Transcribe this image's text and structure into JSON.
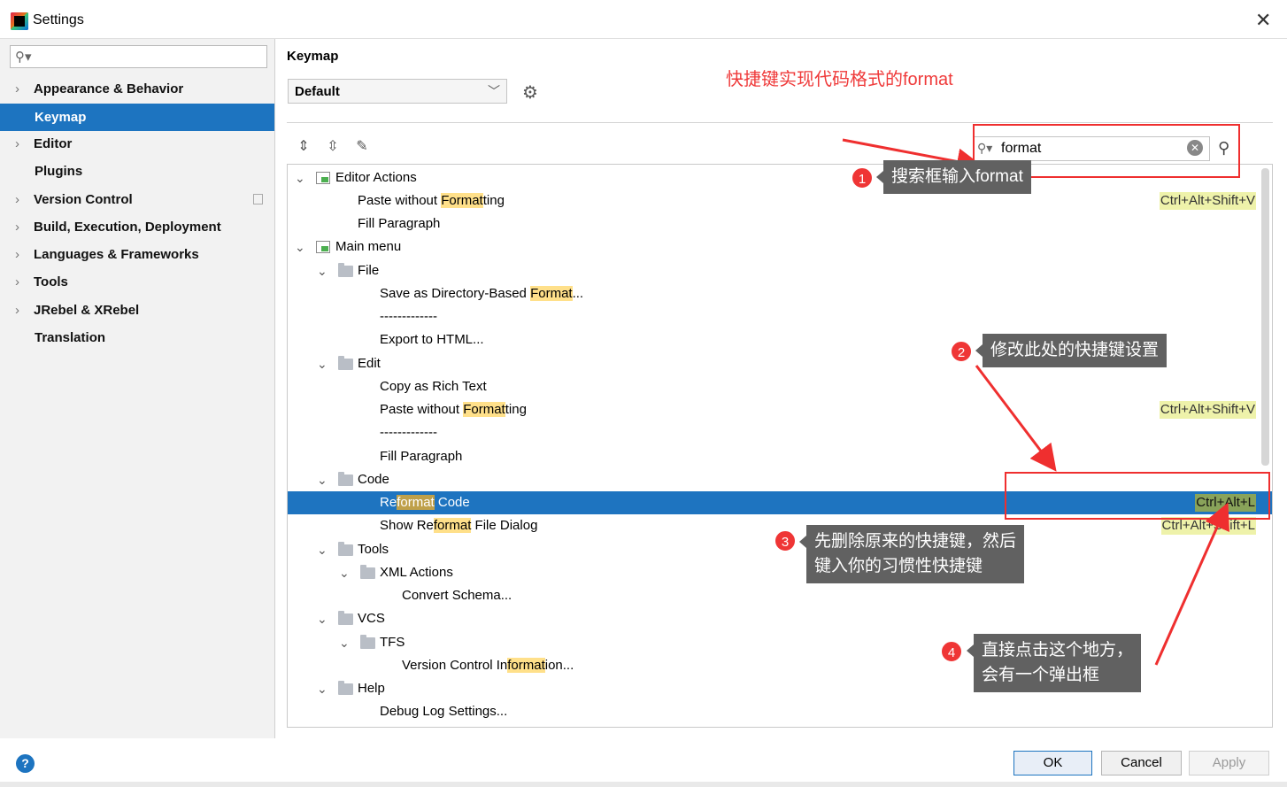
{
  "window": {
    "title": "Settings"
  },
  "sidebar": {
    "search_placeholder": "",
    "items": [
      {
        "label": "Appearance & Behavior",
        "expandable": true
      },
      {
        "label": "Keymap",
        "selected": true
      },
      {
        "label": "Editor",
        "expandable": true
      },
      {
        "label": "Plugins"
      },
      {
        "label": "Version Control",
        "expandable": true
      },
      {
        "label": "Build, Execution, Deployment",
        "expandable": true
      },
      {
        "label": "Languages & Frameworks",
        "expandable": true
      },
      {
        "label": "Tools",
        "expandable": true
      },
      {
        "label": "JRebel & XRebel",
        "expandable": true
      },
      {
        "label": "Translation"
      }
    ]
  },
  "main": {
    "title": "Keymap",
    "keymap_select": "Default",
    "search_value": "format",
    "tree": [
      {
        "pre": "Editor Actions",
        "hl": "",
        "post": "",
        "shortcut": ""
      },
      {
        "pre": "Paste without ",
        "hl": "Format",
        "post": "ting",
        "shortcut": "Ctrl+Alt+Shift+V"
      },
      {
        "pre": "Fill Paragraph",
        "hl": "",
        "post": "",
        "shortcut": ""
      },
      {
        "pre": "Main menu",
        "hl": "",
        "post": "",
        "shortcut": ""
      },
      {
        "pre": "File",
        "hl": "",
        "post": "",
        "shortcut": ""
      },
      {
        "pre": "Save as Directory-Based ",
        "hl": "Format",
        "post": "...",
        "shortcut": ""
      },
      {
        "pre": "-------------",
        "hl": "",
        "post": "",
        "shortcut": ""
      },
      {
        "pre": "Export to HTML...",
        "hl": "",
        "post": "",
        "shortcut": ""
      },
      {
        "pre": "Edit",
        "hl": "",
        "post": "",
        "shortcut": ""
      },
      {
        "pre": "Copy as Rich Text",
        "hl": "",
        "post": "",
        "shortcut": ""
      },
      {
        "pre": "Paste without ",
        "hl": "Format",
        "post": "ting",
        "shortcut": "Ctrl+Alt+Shift+V"
      },
      {
        "pre": "-------------",
        "hl": "",
        "post": "",
        "shortcut": ""
      },
      {
        "pre": "Fill Paragraph",
        "hl": "",
        "post": "",
        "shortcut": ""
      },
      {
        "pre": "Code",
        "hl": "",
        "post": "",
        "shortcut": ""
      },
      {
        "pre": "Re",
        "hl": "format",
        "post": " Code",
        "shortcut": "Ctrl+Alt+L"
      },
      {
        "pre": "Show Re",
        "hl": "format",
        "post": " File Dialog",
        "shortcut": "Ctrl+Alt+Shift+L"
      },
      {
        "pre": "Tools",
        "hl": "",
        "post": "",
        "shortcut": ""
      },
      {
        "pre": "XML Actions",
        "hl": "",
        "post": "",
        "shortcut": ""
      },
      {
        "pre": "Convert Schema...",
        "hl": "",
        "post": "",
        "shortcut": ""
      },
      {
        "pre": "VCS",
        "hl": "",
        "post": "",
        "shortcut": ""
      },
      {
        "pre": "TFS",
        "hl": "",
        "post": "",
        "shortcut": ""
      },
      {
        "pre": "Version Control In",
        "hl": "format",
        "post": "ion...",
        "shortcut": ""
      },
      {
        "pre": "Help",
        "hl": "",
        "post": "",
        "shortcut": ""
      },
      {
        "pre": "Debug Log Settings...",
        "hl": "",
        "post": "",
        "shortcut": ""
      }
    ]
  },
  "annotations": {
    "title": "快捷键实现代码格式的format",
    "steps": [
      {
        "num": "1",
        "lines": [
          "搜索框输入format"
        ]
      },
      {
        "num": "2",
        "lines": [
          "修改此处的快捷键设置"
        ]
      },
      {
        "num": "3",
        "lines": [
          "先删除原来的快捷键，然后",
          "键入你的习惯性快捷键"
        ]
      },
      {
        "num": "4",
        "lines": [
          "直接点击这个地方，",
          "会有一个弹出框"
        ]
      }
    ]
  },
  "buttons": {
    "ok": "OK",
    "cancel": "Cancel",
    "apply": "Apply",
    "help": "?"
  },
  "colors": {
    "selection": "#1e74c0",
    "highlight": "#ffe08a",
    "annotation_red": "#ef3535",
    "tooltip": "#616161"
  }
}
